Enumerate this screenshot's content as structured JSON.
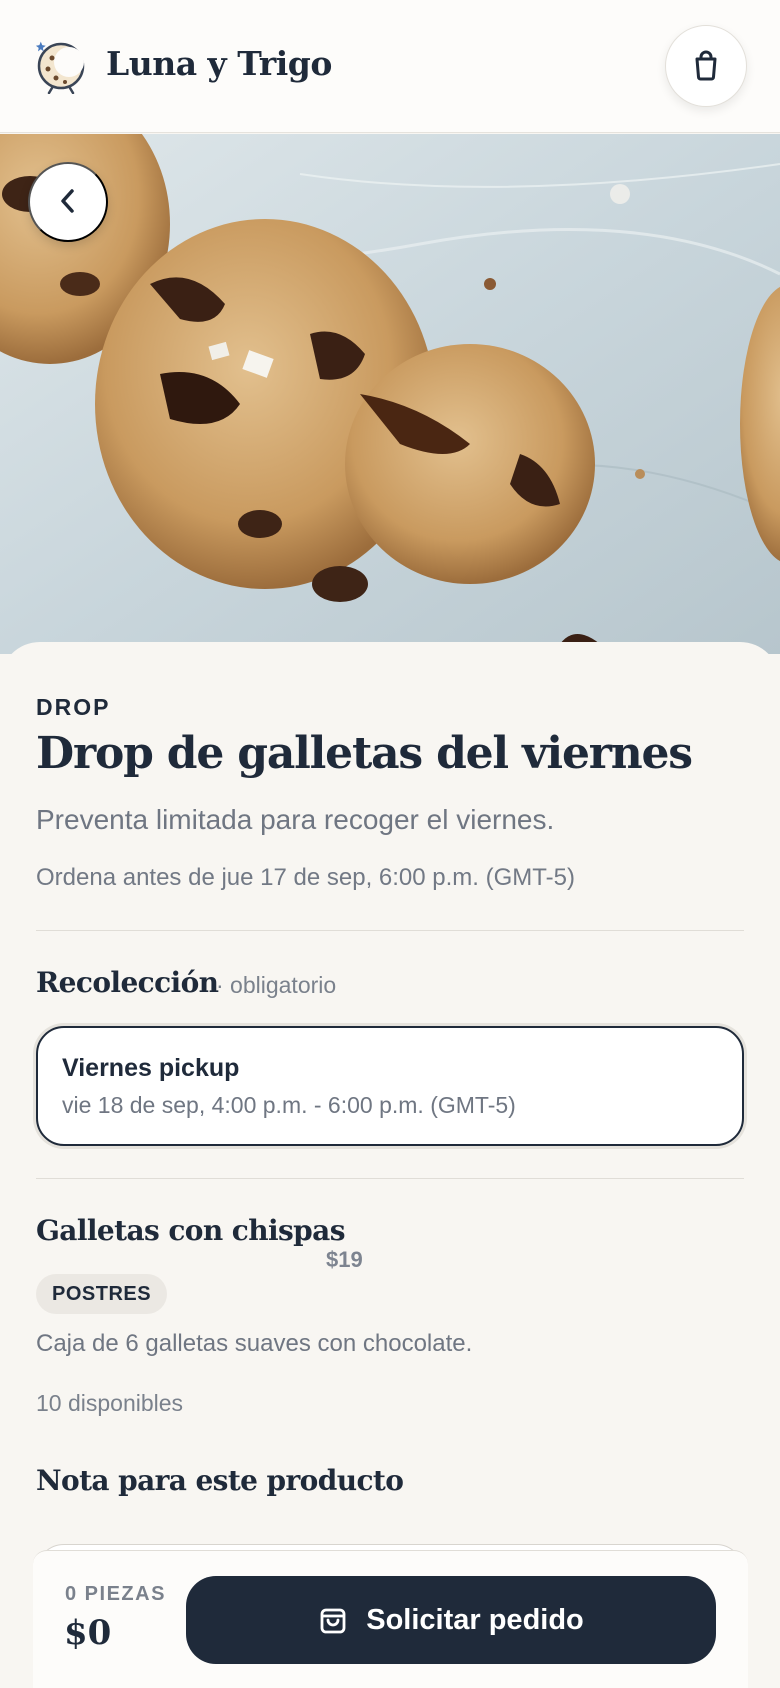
{
  "header": {
    "brand_name": "Luna y Trigo",
    "logo_icon": "cookie-moon-icon",
    "cart_icon": "shopping-bag-icon"
  },
  "hero": {
    "image": "chocolate-chip-cookies-photo",
    "back_icon": "chevron-left-icon"
  },
  "drop": {
    "eyebrow": "DROP",
    "title": "Drop de galletas del viernes",
    "subtitle": "Preventa limitada para recoger el viernes.",
    "deadline": "Ordena antes de jue 17 de sep, 6:00 p.m. (GMT-5)"
  },
  "pickup": {
    "section_title": "Recolección",
    "required_label": "· obligatorio",
    "option": {
      "name": "Viernes pickup",
      "time": "vie 18 de sep, 4:00 p.m. - 6:00 p.m. (GMT-5)"
    }
  },
  "product": {
    "name": "Galletas con chispas",
    "price": "$19",
    "tag": "POSTRES",
    "description": "Caja de 6 galletas suaves con chocolate.",
    "stock": "10 disponibles",
    "note_title": "Nota para este producto"
  },
  "bottom_bar": {
    "pieces_label": "0 PIEZAS",
    "total": "$0",
    "order_button_label": "Solicitar pedido",
    "order_icon": "shopping-bag-icon"
  },
  "colors": {
    "primary": "#1f2a3a",
    "background": "#f8f6f2",
    "muted_text": "#6f7682"
  }
}
